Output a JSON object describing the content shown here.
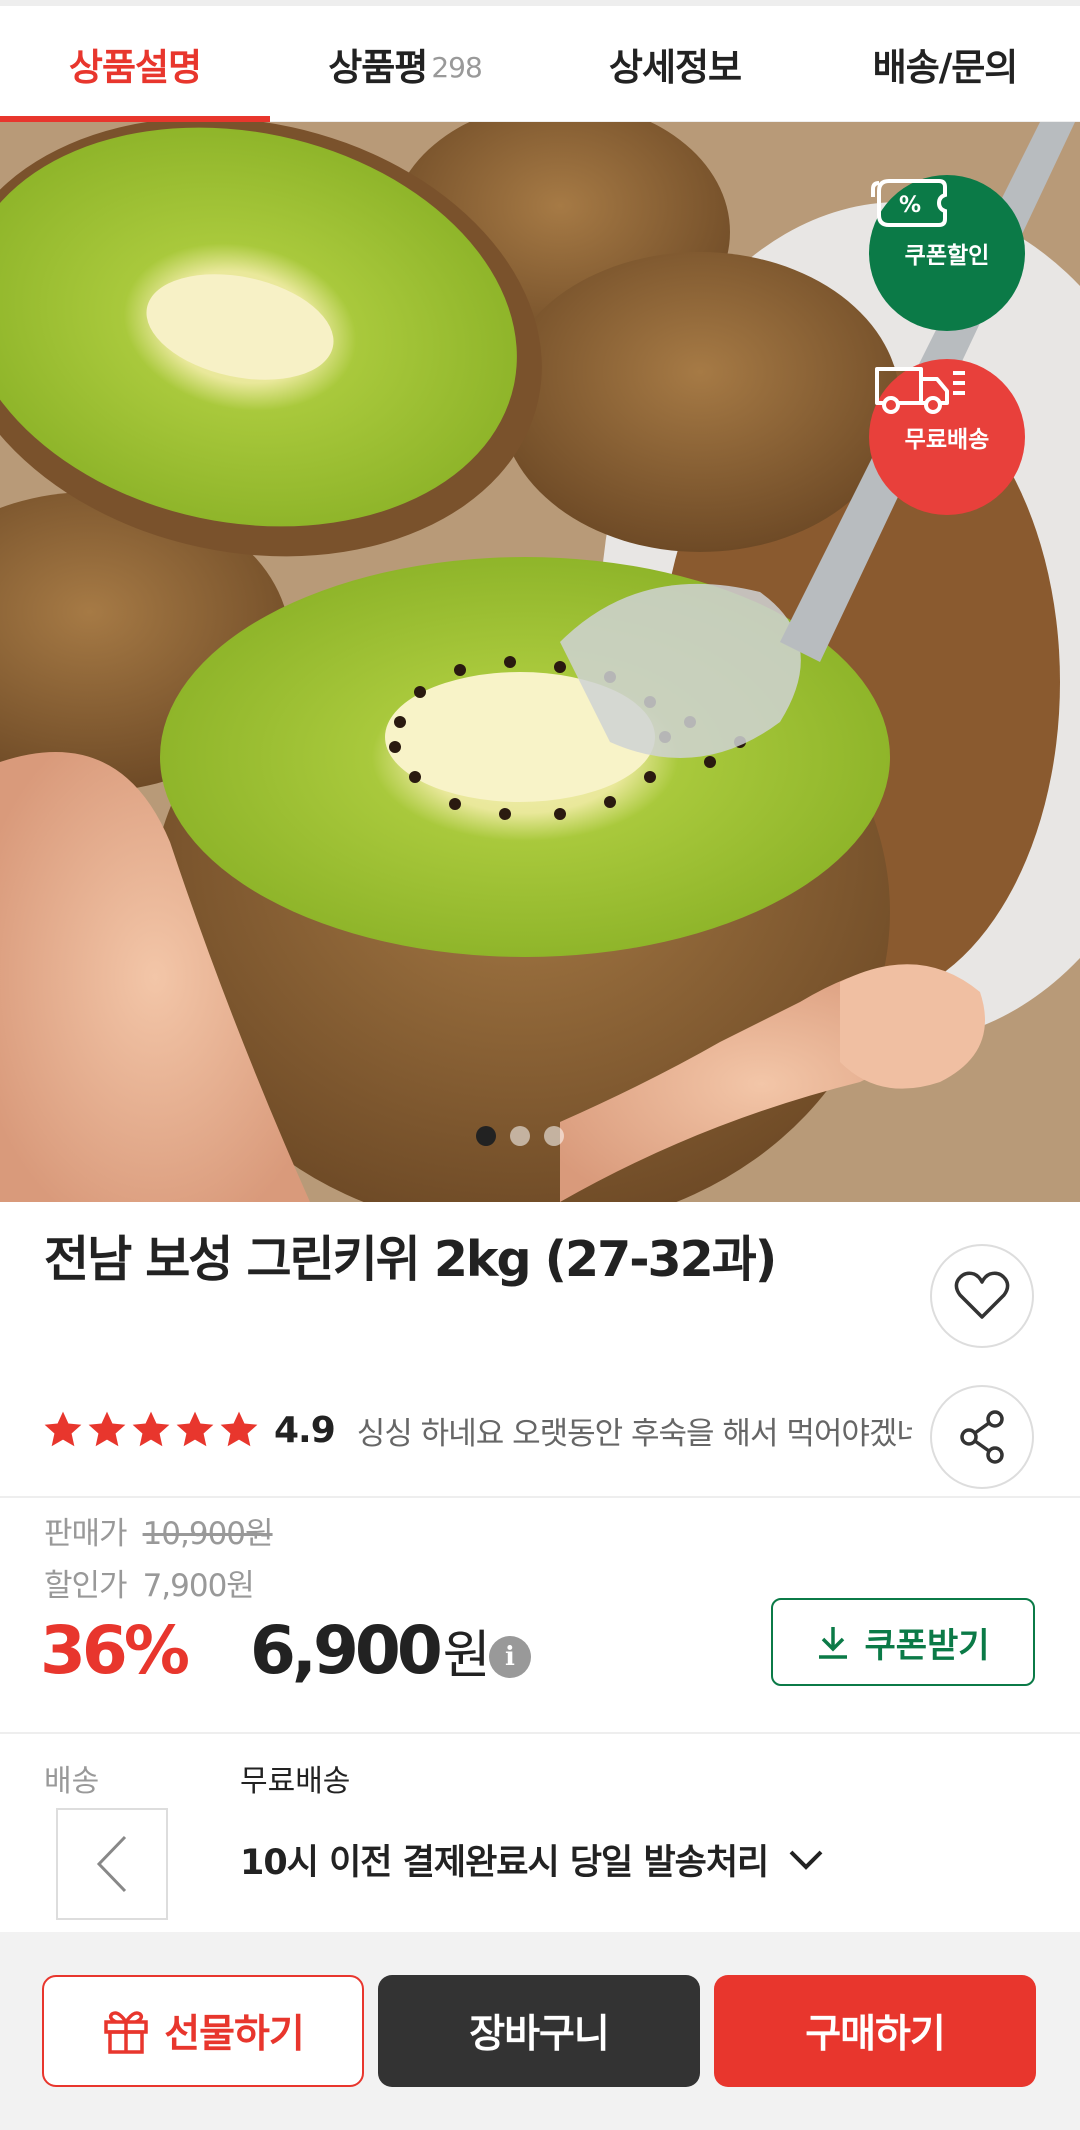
{
  "tabs": [
    {
      "label": "상품설명",
      "count": ""
    },
    {
      "label": "상품평",
      "count": "298"
    },
    {
      "label": "상세정보",
      "count": ""
    },
    {
      "label": "배송/문의",
      "count": ""
    }
  ],
  "hero": {
    "badges": {
      "coupon": "쿠폰할인",
      "free_shipping": "무료배송",
      "coupon_symbol": "%"
    },
    "carousel": {
      "total": 3,
      "active": 1
    }
  },
  "product": {
    "title": "전남 보성 그린키위 2kg (27-32과)",
    "rating": {
      "stars": 5,
      "score": "4.9",
      "review_snippet": "싱싱 하네요 오랫동안 후숙을 해서 먹어야겠네요"
    },
    "price": {
      "sale_label": "판매가",
      "sale_price": "10,900원",
      "discount_label": "할인가",
      "discount_price": "7,900원",
      "percent": "36%",
      "final_amount": "6,900",
      "final_unit": "원",
      "info_symbol": "i",
      "coupon_button": "쿠폰받기"
    },
    "shipping": {
      "label": "배송",
      "type": "무료배송",
      "note": "10시 이전 결제완료시 당일 발송처리"
    }
  },
  "actions": {
    "gift": "선물하기",
    "cart": "장바구니",
    "buy": "구매하기"
  },
  "colors": {
    "accent": "#e8362d",
    "coupon_green": "#0b7a47",
    "dark": "#333333"
  }
}
